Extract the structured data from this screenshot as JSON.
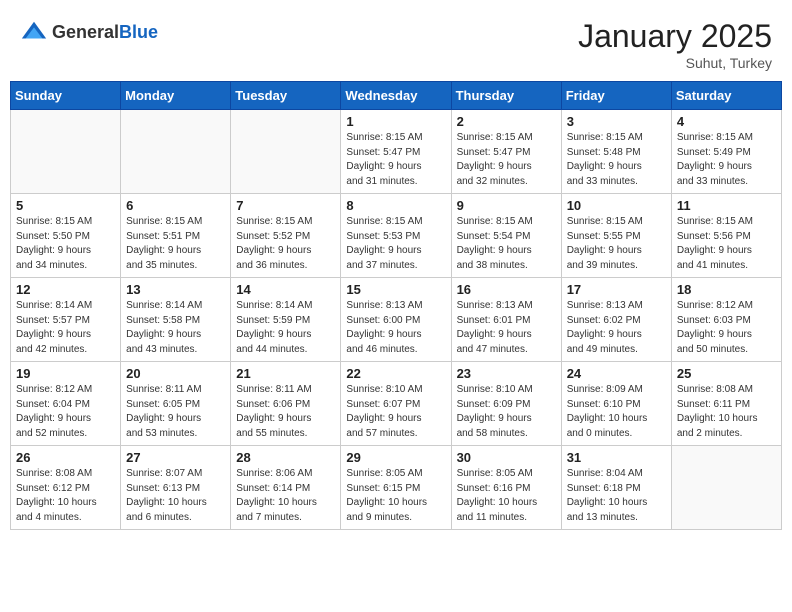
{
  "logo": {
    "general": "General",
    "blue": "Blue"
  },
  "title": "January 2025",
  "location": "Suhut, Turkey",
  "weekdays": [
    "Sunday",
    "Monday",
    "Tuesday",
    "Wednesday",
    "Thursday",
    "Friday",
    "Saturday"
  ],
  "weeks": [
    [
      {
        "day": "",
        "info": ""
      },
      {
        "day": "",
        "info": ""
      },
      {
        "day": "",
        "info": ""
      },
      {
        "day": "1",
        "info": "Sunrise: 8:15 AM\nSunset: 5:47 PM\nDaylight: 9 hours\nand 31 minutes."
      },
      {
        "day": "2",
        "info": "Sunrise: 8:15 AM\nSunset: 5:47 PM\nDaylight: 9 hours\nand 32 minutes."
      },
      {
        "day": "3",
        "info": "Sunrise: 8:15 AM\nSunset: 5:48 PM\nDaylight: 9 hours\nand 33 minutes."
      },
      {
        "day": "4",
        "info": "Sunrise: 8:15 AM\nSunset: 5:49 PM\nDaylight: 9 hours\nand 33 minutes."
      }
    ],
    [
      {
        "day": "5",
        "info": "Sunrise: 8:15 AM\nSunset: 5:50 PM\nDaylight: 9 hours\nand 34 minutes."
      },
      {
        "day": "6",
        "info": "Sunrise: 8:15 AM\nSunset: 5:51 PM\nDaylight: 9 hours\nand 35 minutes."
      },
      {
        "day": "7",
        "info": "Sunrise: 8:15 AM\nSunset: 5:52 PM\nDaylight: 9 hours\nand 36 minutes."
      },
      {
        "day": "8",
        "info": "Sunrise: 8:15 AM\nSunset: 5:53 PM\nDaylight: 9 hours\nand 37 minutes."
      },
      {
        "day": "9",
        "info": "Sunrise: 8:15 AM\nSunset: 5:54 PM\nDaylight: 9 hours\nand 38 minutes."
      },
      {
        "day": "10",
        "info": "Sunrise: 8:15 AM\nSunset: 5:55 PM\nDaylight: 9 hours\nand 39 minutes."
      },
      {
        "day": "11",
        "info": "Sunrise: 8:15 AM\nSunset: 5:56 PM\nDaylight: 9 hours\nand 41 minutes."
      }
    ],
    [
      {
        "day": "12",
        "info": "Sunrise: 8:14 AM\nSunset: 5:57 PM\nDaylight: 9 hours\nand 42 minutes."
      },
      {
        "day": "13",
        "info": "Sunrise: 8:14 AM\nSunset: 5:58 PM\nDaylight: 9 hours\nand 43 minutes."
      },
      {
        "day": "14",
        "info": "Sunrise: 8:14 AM\nSunset: 5:59 PM\nDaylight: 9 hours\nand 44 minutes."
      },
      {
        "day": "15",
        "info": "Sunrise: 8:13 AM\nSunset: 6:00 PM\nDaylight: 9 hours\nand 46 minutes."
      },
      {
        "day": "16",
        "info": "Sunrise: 8:13 AM\nSunset: 6:01 PM\nDaylight: 9 hours\nand 47 minutes."
      },
      {
        "day": "17",
        "info": "Sunrise: 8:13 AM\nSunset: 6:02 PM\nDaylight: 9 hours\nand 49 minutes."
      },
      {
        "day": "18",
        "info": "Sunrise: 8:12 AM\nSunset: 6:03 PM\nDaylight: 9 hours\nand 50 minutes."
      }
    ],
    [
      {
        "day": "19",
        "info": "Sunrise: 8:12 AM\nSunset: 6:04 PM\nDaylight: 9 hours\nand 52 minutes."
      },
      {
        "day": "20",
        "info": "Sunrise: 8:11 AM\nSunset: 6:05 PM\nDaylight: 9 hours\nand 53 minutes."
      },
      {
        "day": "21",
        "info": "Sunrise: 8:11 AM\nSunset: 6:06 PM\nDaylight: 9 hours\nand 55 minutes."
      },
      {
        "day": "22",
        "info": "Sunrise: 8:10 AM\nSunset: 6:07 PM\nDaylight: 9 hours\nand 57 minutes."
      },
      {
        "day": "23",
        "info": "Sunrise: 8:10 AM\nSunset: 6:09 PM\nDaylight: 9 hours\nand 58 minutes."
      },
      {
        "day": "24",
        "info": "Sunrise: 8:09 AM\nSunset: 6:10 PM\nDaylight: 10 hours\nand 0 minutes."
      },
      {
        "day": "25",
        "info": "Sunrise: 8:08 AM\nSunset: 6:11 PM\nDaylight: 10 hours\nand 2 minutes."
      }
    ],
    [
      {
        "day": "26",
        "info": "Sunrise: 8:08 AM\nSunset: 6:12 PM\nDaylight: 10 hours\nand 4 minutes."
      },
      {
        "day": "27",
        "info": "Sunrise: 8:07 AM\nSunset: 6:13 PM\nDaylight: 10 hours\nand 6 minutes."
      },
      {
        "day": "28",
        "info": "Sunrise: 8:06 AM\nSunset: 6:14 PM\nDaylight: 10 hours\nand 7 minutes."
      },
      {
        "day": "29",
        "info": "Sunrise: 8:05 AM\nSunset: 6:15 PM\nDaylight: 10 hours\nand 9 minutes."
      },
      {
        "day": "30",
        "info": "Sunrise: 8:05 AM\nSunset: 6:16 PM\nDaylight: 10 hours\nand 11 minutes."
      },
      {
        "day": "31",
        "info": "Sunrise: 8:04 AM\nSunset: 6:18 PM\nDaylight: 10 hours\nand 13 minutes."
      },
      {
        "day": "",
        "info": ""
      }
    ]
  ]
}
